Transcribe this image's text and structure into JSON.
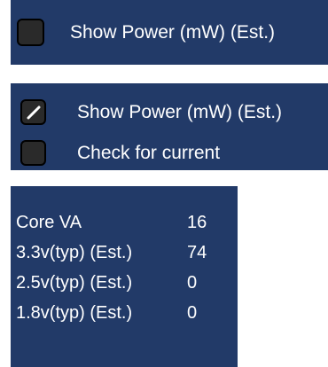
{
  "options": [
    {
      "label": "Show Power (mW) (Est.)",
      "checked": false
    },
    {
      "label": "Show Power (mW) (Est.)",
      "checked": true
    },
    {
      "label": "Check for current",
      "checked": false
    }
  ],
  "voltages": [
    {
      "label": "Core VA",
      "value": "16"
    },
    {
      "label": "3.3v(typ) (Est.)",
      "value": "74"
    },
    {
      "label": "2.5v(typ) (Est.)",
      "value": "0"
    },
    {
      "label": "1.8v(typ) (Est.)",
      "value": "0"
    }
  ],
  "colors": {
    "panel": "#223a68",
    "checkbox_fill": "#2a2a2a",
    "text": "#ffffff"
  },
  "icons": {
    "checked": "check-slash-icon"
  }
}
